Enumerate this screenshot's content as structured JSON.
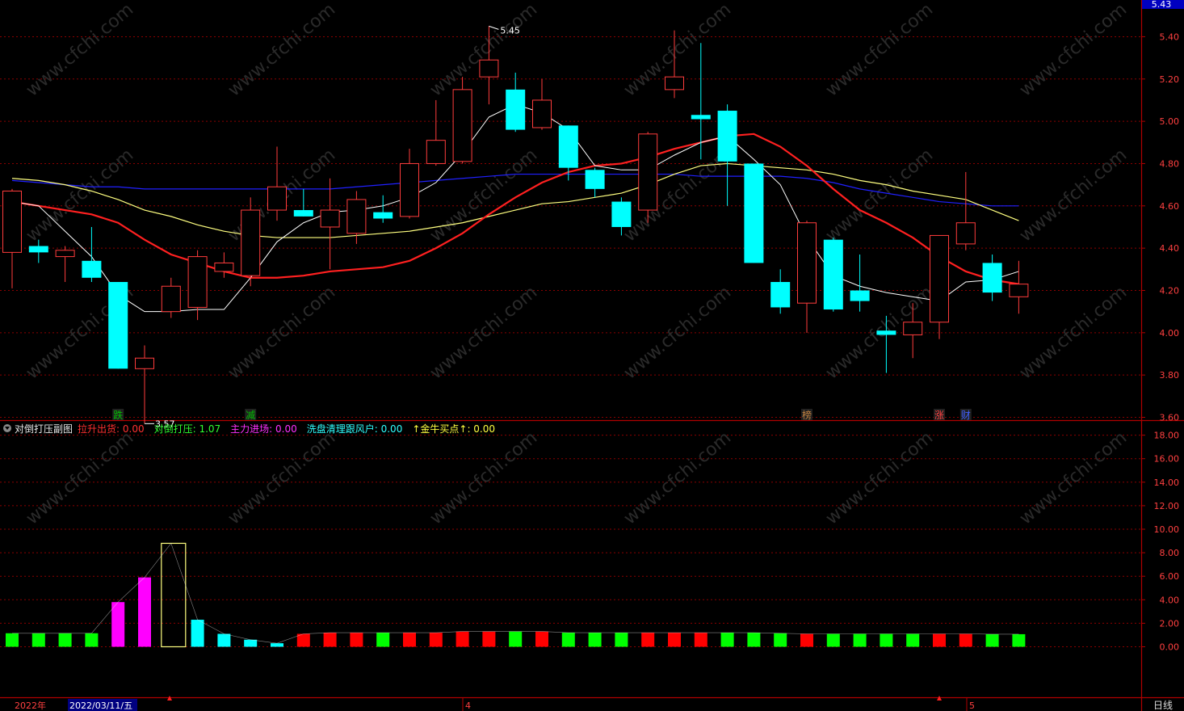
{
  "app": {
    "period_label": "日线"
  },
  "colors": {
    "up": "#ff3c3c",
    "down": "#00ffff",
    "ma5": "#ffffff",
    "ma10": "#ff2020",
    "ma20": "#ffff80",
    "ma60": "#2020ff",
    "grid": "#8b0000",
    "axis_text": "#ff4040"
  },
  "main_panel": {
    "price_ticks": [
      "5.40",
      "5.20",
      "5.00",
      "4.80",
      "4.60",
      "4.40",
      "4.20",
      "4.00",
      "3.80",
      "3.60"
    ],
    "last_price": "5.43",
    "high_label": "5.45",
    "low_label": "3.57",
    "markers": [
      {
        "text": "跌",
        "bar": 4,
        "color": "#00c000"
      },
      {
        "text": "减",
        "bar": 9,
        "color": "#00c000"
      },
      {
        "text": "榜",
        "bar": 30,
        "color": "#c08040"
      },
      {
        "text": "涨",
        "bar": 35,
        "color": "#ff4040"
      },
      {
        "text": "财",
        "bar": 36,
        "color": "#4060ff"
      }
    ]
  },
  "sub_panel": {
    "title": "对倒打压副图",
    "ticks": [
      "18.00",
      "16.00",
      "14.00",
      "12.00",
      "10.00",
      "8.00",
      "6.00",
      "4.00",
      "2.00",
      "0.00"
    ],
    "legend": [
      {
        "label": "拉升出货: 0.00",
        "color": "#ff3030"
      },
      {
        "label": "对倒打压: 1.07",
        "color": "#30ff30"
      },
      {
        "label": "主力进场: 0.00",
        "color": "#ff30ff"
      },
      {
        "label": "洗盘清理跟风户: 0.00",
        "color": "#30ffff"
      },
      {
        "label": "↑金牛买点↑: 0.00",
        "color": "#ffff40"
      }
    ]
  },
  "time_axis": {
    "year_label": "2022年",
    "cursor_date": "2022/03/11/五",
    "month_labels": [
      "4",
      "5"
    ]
  },
  "watermark": "www.cfchi.com",
  "chart_data": {
    "type": "candlestick",
    "y_range": [
      3.52,
      5.45
    ],
    "candles": [
      {
        "o": 4.38,
        "h": 4.68,
        "l": 4.21,
        "c": 4.67
      },
      {
        "o": 4.41,
        "h": 4.44,
        "l": 4.33,
        "c": 4.38
      },
      {
        "o": 4.36,
        "h": 4.41,
        "l": 4.24,
        "c": 4.39
      },
      {
        "o": 4.34,
        "h": 4.5,
        "l": 4.24,
        "c": 4.26
      },
      {
        "o": 4.24,
        "h": 4.24,
        "l": 3.83,
        "c": 3.83
      },
      {
        "o": 3.83,
        "h": 3.94,
        "l": 3.57,
        "c": 3.88
      },
      {
        "o": 4.1,
        "h": 4.26,
        "l": 4.07,
        "c": 4.22
      },
      {
        "o": 4.12,
        "h": 4.39,
        "l": 4.06,
        "c": 4.36
      },
      {
        "o": 4.29,
        "h": 4.38,
        "l": 4.26,
        "c": 4.33
      },
      {
        "o": 4.27,
        "h": 4.64,
        "l": 4.22,
        "c": 4.58
      },
      {
        "o": 4.58,
        "h": 4.88,
        "l": 4.53,
        "c": 4.69
      },
      {
        "o": 4.58,
        "h": 4.68,
        "l": 4.55,
        "c": 4.55
      },
      {
        "o": 4.5,
        "h": 4.73,
        "l": 4.3,
        "c": 4.58
      },
      {
        "o": 4.47,
        "h": 4.67,
        "l": 4.42,
        "c": 4.63
      },
      {
        "o": 4.57,
        "h": 4.65,
        "l": 4.52,
        "c": 4.54
      },
      {
        "o": 4.55,
        "h": 4.87,
        "l": 4.54,
        "c": 4.8
      },
      {
        "o": 4.8,
        "h": 5.1,
        "l": 4.79,
        "c": 4.91
      },
      {
        "o": 4.81,
        "h": 5.21,
        "l": 4.8,
        "c": 5.15
      },
      {
        "o": 5.21,
        "h": 5.45,
        "l": 5.08,
        "c": 5.29
      },
      {
        "o": 5.15,
        "h": 5.23,
        "l": 4.95,
        "c": 4.96
      },
      {
        "o": 4.97,
        "h": 5.2,
        "l": 4.96,
        "c": 5.1
      },
      {
        "o": 4.98,
        "h": 4.98,
        "l": 4.72,
        "c": 4.78
      },
      {
        "o": 4.77,
        "h": 4.78,
        "l": 4.64,
        "c": 4.68
      },
      {
        "o": 4.62,
        "h": 4.64,
        "l": 4.46,
        "c": 4.5
      },
      {
        "o": 4.58,
        "h": 4.95,
        "l": 4.52,
        "c": 4.94
      },
      {
        "o": 5.15,
        "h": 5.43,
        "l": 5.11,
        "c": 5.21
      },
      {
        "o": 5.03,
        "h": 5.37,
        "l": 4.82,
        "c": 5.01
      },
      {
        "o": 5.05,
        "h": 5.08,
        "l": 4.6,
        "c": 4.81
      },
      {
        "o": 4.8,
        "h": 4.8,
        "l": 4.33,
        "c": 4.33
      },
      {
        "o": 4.24,
        "h": 4.3,
        "l": 4.09,
        "c": 4.12
      },
      {
        "o": 4.14,
        "h": 4.53,
        "l": 4.0,
        "c": 4.52
      },
      {
        "o": 4.44,
        "h": 4.45,
        "l": 4.1,
        "c": 4.11
      },
      {
        "o": 4.2,
        "h": 4.37,
        "l": 4.1,
        "c": 4.15
      },
      {
        "o": 4.01,
        "h": 4.08,
        "l": 3.81,
        "c": 3.99
      },
      {
        "o": 3.99,
        "h": 4.14,
        "l": 3.88,
        "c": 4.05
      },
      {
        "o": 4.05,
        "h": 4.46,
        "l": 3.97,
        "c": 4.46
      },
      {
        "o": 4.42,
        "h": 4.76,
        "l": 4.39,
        "c": 4.52
      },
      {
        "o": 4.33,
        "h": 4.37,
        "l": 4.15,
        "c": 4.19
      },
      {
        "o": 4.17,
        "h": 4.34,
        "l": 4.09,
        "c": 4.23
      }
    ],
    "ma5": [
      4.62,
      4.6,
      4.48,
      4.36,
      4.18,
      4.1,
      4.1,
      4.11,
      4.11,
      4.26,
      4.43,
      4.52,
      4.57,
      4.58,
      4.6,
      4.64,
      4.71,
      4.85,
      5.02,
      5.08,
      5.04,
      4.96,
      4.79,
      4.77,
      4.77,
      4.84,
      4.9,
      4.93,
      4.82,
      4.7,
      4.45,
      4.27,
      4.22,
      4.19,
      4.17,
      4.15,
      4.24,
      4.25,
      4.29
    ],
    "ma10": [
      4.62,
      4.6,
      4.58,
      4.56,
      4.52,
      4.44,
      4.37,
      4.33,
      4.29,
      4.26,
      4.26,
      4.27,
      4.29,
      4.3,
      4.31,
      4.34,
      4.4,
      4.47,
      4.56,
      4.64,
      4.71,
      4.76,
      4.79,
      4.8,
      4.83,
      4.87,
      4.9,
      4.93,
      4.94,
      4.88,
      4.79,
      4.68,
      4.58,
      4.52,
      4.45,
      4.36,
      4.29,
      4.25,
      4.23
    ],
    "ma20": [
      4.73,
      4.72,
      4.7,
      4.67,
      4.63,
      4.58,
      4.55,
      4.51,
      4.48,
      4.46,
      4.45,
      4.45,
      4.45,
      4.46,
      4.47,
      4.48,
      4.5,
      4.52,
      4.55,
      4.58,
      4.61,
      4.62,
      4.64,
      4.66,
      4.7,
      4.75,
      4.79,
      4.8,
      4.79,
      4.78,
      4.77,
      4.75,
      4.72,
      4.7,
      4.67,
      4.65,
      4.63,
      4.58,
      4.53
    ],
    "ma60": [
      4.72,
      4.71,
      4.7,
      4.69,
      4.69,
      4.68,
      4.68,
      4.68,
      4.68,
      4.68,
      4.68,
      4.68,
      4.68,
      4.69,
      4.7,
      4.71,
      4.72,
      4.73,
      4.74,
      4.75,
      4.75,
      4.75,
      4.75,
      4.75,
      4.75,
      4.75,
      4.74,
      4.74,
      4.74,
      4.74,
      4.73,
      4.71,
      4.68,
      4.66,
      4.64,
      4.62,
      4.61,
      4.6,
      4.6
    ],
    "sub_range": [
      0,
      18.8
    ],
    "sub_bars": [
      {
        "v": 1.15,
        "c": "#00ff00"
      },
      {
        "v": 1.15,
        "c": "#00ff00"
      },
      {
        "v": 1.15,
        "c": "#00ff00"
      },
      {
        "v": 1.15,
        "c": "#00ff00"
      },
      {
        "v": 3.8,
        "c": "#ff00ff"
      },
      {
        "v": 5.9,
        "c": "#ff00ff"
      },
      {
        "v": 8.8,
        "c": "outline-yellow"
      },
      {
        "v": 2.3,
        "c": "#00ffff"
      },
      {
        "v": 1.1,
        "c": "#00ffff"
      },
      {
        "v": 0.6,
        "c": "#00ffff"
      },
      {
        "v": 0.3,
        "c": "#00ffff"
      },
      {
        "v": 1.1,
        "c": "#ff0000"
      },
      {
        "v": 1.2,
        "c": "#ff0000"
      },
      {
        "v": 1.2,
        "c": "#ff0000"
      },
      {
        "v": 1.2,
        "c": "#00ff00"
      },
      {
        "v": 1.2,
        "c": "#ff0000"
      },
      {
        "v": 1.2,
        "c": "#ff0000"
      },
      {
        "v": 1.3,
        "c": "#ff0000"
      },
      {
        "v": 1.3,
        "c": "#ff0000"
      },
      {
        "v": 1.3,
        "c": "#00ff00"
      },
      {
        "v": 1.3,
        "c": "#ff0000"
      },
      {
        "v": 1.2,
        "c": "#00ff00"
      },
      {
        "v": 1.2,
        "c": "#00ff00"
      },
      {
        "v": 1.2,
        "c": "#00ff00"
      },
      {
        "v": 1.2,
        "c": "#ff0000"
      },
      {
        "v": 1.2,
        "c": "#ff0000"
      },
      {
        "v": 1.2,
        "c": "#ff0000"
      },
      {
        "v": 1.2,
        "c": "#00ff00"
      },
      {
        "v": 1.2,
        "c": "#00ff00"
      },
      {
        "v": 1.15,
        "c": "#00ff00"
      },
      {
        "v": 1.1,
        "c": "#ff0000"
      },
      {
        "v": 1.1,
        "c": "#00ff00"
      },
      {
        "v": 1.1,
        "c": "#00ff00"
      },
      {
        "v": 1.1,
        "c": "#00ff00"
      },
      {
        "v": 1.1,
        "c": "#00ff00"
      },
      {
        "v": 1.1,
        "c": "#ff0000"
      },
      {
        "v": 1.1,
        "c": "#ff0000"
      },
      {
        "v": 1.07,
        "c": "#00ff00"
      },
      {
        "v": 1.07,
        "c": "#00ff00"
      }
    ]
  }
}
